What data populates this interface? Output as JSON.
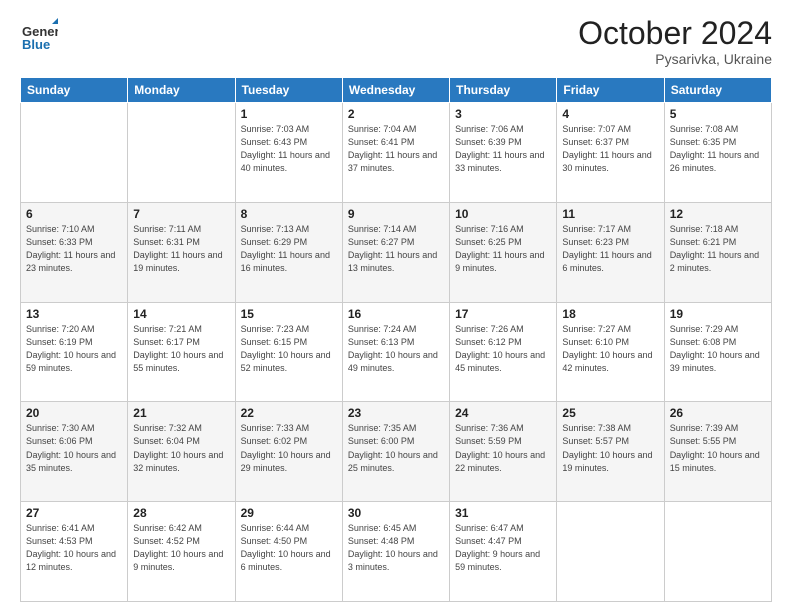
{
  "logo": {
    "general": "General",
    "blue": "Blue"
  },
  "title": "October 2024",
  "location": "Pysarivka, Ukraine",
  "weekdays": [
    "Sunday",
    "Monday",
    "Tuesday",
    "Wednesday",
    "Thursday",
    "Friday",
    "Saturday"
  ],
  "weeks": [
    [
      {
        "day": "",
        "info": ""
      },
      {
        "day": "",
        "info": ""
      },
      {
        "day": "1",
        "info": "Sunrise: 7:03 AM\nSunset: 6:43 PM\nDaylight: 11 hours and 40 minutes."
      },
      {
        "day": "2",
        "info": "Sunrise: 7:04 AM\nSunset: 6:41 PM\nDaylight: 11 hours and 37 minutes."
      },
      {
        "day": "3",
        "info": "Sunrise: 7:06 AM\nSunset: 6:39 PM\nDaylight: 11 hours and 33 minutes."
      },
      {
        "day": "4",
        "info": "Sunrise: 7:07 AM\nSunset: 6:37 PM\nDaylight: 11 hours and 30 minutes."
      },
      {
        "day": "5",
        "info": "Sunrise: 7:08 AM\nSunset: 6:35 PM\nDaylight: 11 hours and 26 minutes."
      }
    ],
    [
      {
        "day": "6",
        "info": "Sunrise: 7:10 AM\nSunset: 6:33 PM\nDaylight: 11 hours and 23 minutes."
      },
      {
        "day": "7",
        "info": "Sunrise: 7:11 AM\nSunset: 6:31 PM\nDaylight: 11 hours and 19 minutes."
      },
      {
        "day": "8",
        "info": "Sunrise: 7:13 AM\nSunset: 6:29 PM\nDaylight: 11 hours and 16 minutes."
      },
      {
        "day": "9",
        "info": "Sunrise: 7:14 AM\nSunset: 6:27 PM\nDaylight: 11 hours and 13 minutes."
      },
      {
        "day": "10",
        "info": "Sunrise: 7:16 AM\nSunset: 6:25 PM\nDaylight: 11 hours and 9 minutes."
      },
      {
        "day": "11",
        "info": "Sunrise: 7:17 AM\nSunset: 6:23 PM\nDaylight: 11 hours and 6 minutes."
      },
      {
        "day": "12",
        "info": "Sunrise: 7:18 AM\nSunset: 6:21 PM\nDaylight: 11 hours and 2 minutes."
      }
    ],
    [
      {
        "day": "13",
        "info": "Sunrise: 7:20 AM\nSunset: 6:19 PM\nDaylight: 10 hours and 59 minutes."
      },
      {
        "day": "14",
        "info": "Sunrise: 7:21 AM\nSunset: 6:17 PM\nDaylight: 10 hours and 55 minutes."
      },
      {
        "day": "15",
        "info": "Sunrise: 7:23 AM\nSunset: 6:15 PM\nDaylight: 10 hours and 52 minutes."
      },
      {
        "day": "16",
        "info": "Sunrise: 7:24 AM\nSunset: 6:13 PM\nDaylight: 10 hours and 49 minutes."
      },
      {
        "day": "17",
        "info": "Sunrise: 7:26 AM\nSunset: 6:12 PM\nDaylight: 10 hours and 45 minutes."
      },
      {
        "day": "18",
        "info": "Sunrise: 7:27 AM\nSunset: 6:10 PM\nDaylight: 10 hours and 42 minutes."
      },
      {
        "day": "19",
        "info": "Sunrise: 7:29 AM\nSunset: 6:08 PM\nDaylight: 10 hours and 39 minutes."
      }
    ],
    [
      {
        "day": "20",
        "info": "Sunrise: 7:30 AM\nSunset: 6:06 PM\nDaylight: 10 hours and 35 minutes."
      },
      {
        "day": "21",
        "info": "Sunrise: 7:32 AM\nSunset: 6:04 PM\nDaylight: 10 hours and 32 minutes."
      },
      {
        "day": "22",
        "info": "Sunrise: 7:33 AM\nSunset: 6:02 PM\nDaylight: 10 hours and 29 minutes."
      },
      {
        "day": "23",
        "info": "Sunrise: 7:35 AM\nSunset: 6:00 PM\nDaylight: 10 hours and 25 minutes."
      },
      {
        "day": "24",
        "info": "Sunrise: 7:36 AM\nSunset: 5:59 PM\nDaylight: 10 hours and 22 minutes."
      },
      {
        "day": "25",
        "info": "Sunrise: 7:38 AM\nSunset: 5:57 PM\nDaylight: 10 hours and 19 minutes."
      },
      {
        "day": "26",
        "info": "Sunrise: 7:39 AM\nSunset: 5:55 PM\nDaylight: 10 hours and 15 minutes."
      }
    ],
    [
      {
        "day": "27",
        "info": "Sunrise: 6:41 AM\nSunset: 4:53 PM\nDaylight: 10 hours and 12 minutes."
      },
      {
        "day": "28",
        "info": "Sunrise: 6:42 AM\nSunset: 4:52 PM\nDaylight: 10 hours and 9 minutes."
      },
      {
        "day": "29",
        "info": "Sunrise: 6:44 AM\nSunset: 4:50 PM\nDaylight: 10 hours and 6 minutes."
      },
      {
        "day": "30",
        "info": "Sunrise: 6:45 AM\nSunset: 4:48 PM\nDaylight: 10 hours and 3 minutes."
      },
      {
        "day": "31",
        "info": "Sunrise: 6:47 AM\nSunset: 4:47 PM\nDaylight: 9 hours and 59 minutes."
      },
      {
        "day": "",
        "info": ""
      },
      {
        "day": "",
        "info": ""
      }
    ]
  ]
}
